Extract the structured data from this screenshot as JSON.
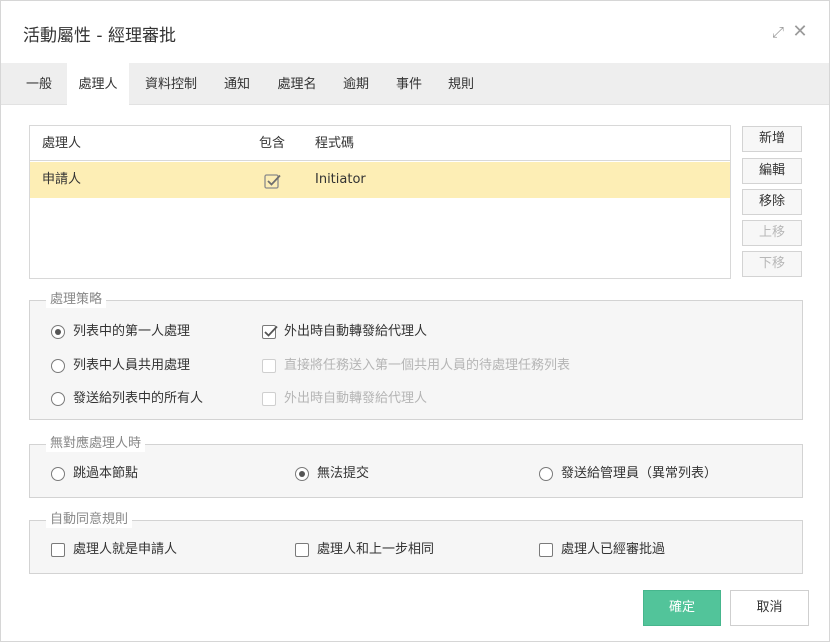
{
  "dialog": {
    "title": "活動屬性 - 經理審批"
  },
  "tabs": [
    "一般",
    "處理人",
    "資料控制",
    "通知",
    "處理名",
    "逾期",
    "事件",
    "規則"
  ],
  "grid": {
    "headers": {
      "handler": "處理人",
      "include": "包含",
      "code": "程式碼"
    },
    "rows": [
      {
        "handler": "申請人",
        "include": true,
        "code": "Initiator"
      }
    ]
  },
  "side_buttons": {
    "add": "新增",
    "edit": "編輯",
    "remove": "移除",
    "up": "上移",
    "down": "下移"
  },
  "strategy": {
    "legend": "處理策略",
    "options": [
      "列表中的第一人處理",
      "列表中人員共用處理",
      "發送給列表中的所有人"
    ],
    "selected": 0,
    "checks": [
      {
        "label": "外出時自動轉發給代理人",
        "checked": true,
        "enabled": true
      },
      {
        "label": "直接將任務送入第一個共用人員的待處理任務列表",
        "checked": false,
        "enabled": false
      },
      {
        "label": "外出時自動轉發給代理人",
        "checked": false,
        "enabled": false
      }
    ]
  },
  "no_handler": {
    "legend": "無對應處理人時",
    "options": [
      "跳過本節點",
      "無法提交",
      "發送給管理員（異常列表）"
    ],
    "selected": 1
  },
  "auto_approve": {
    "legend": "自動同意規則",
    "options": [
      "處理人就是申請人",
      "處理人和上一步相同",
      "處理人已經審批過"
    ]
  },
  "footer": {
    "ok": "確定",
    "cancel": "取消"
  }
}
